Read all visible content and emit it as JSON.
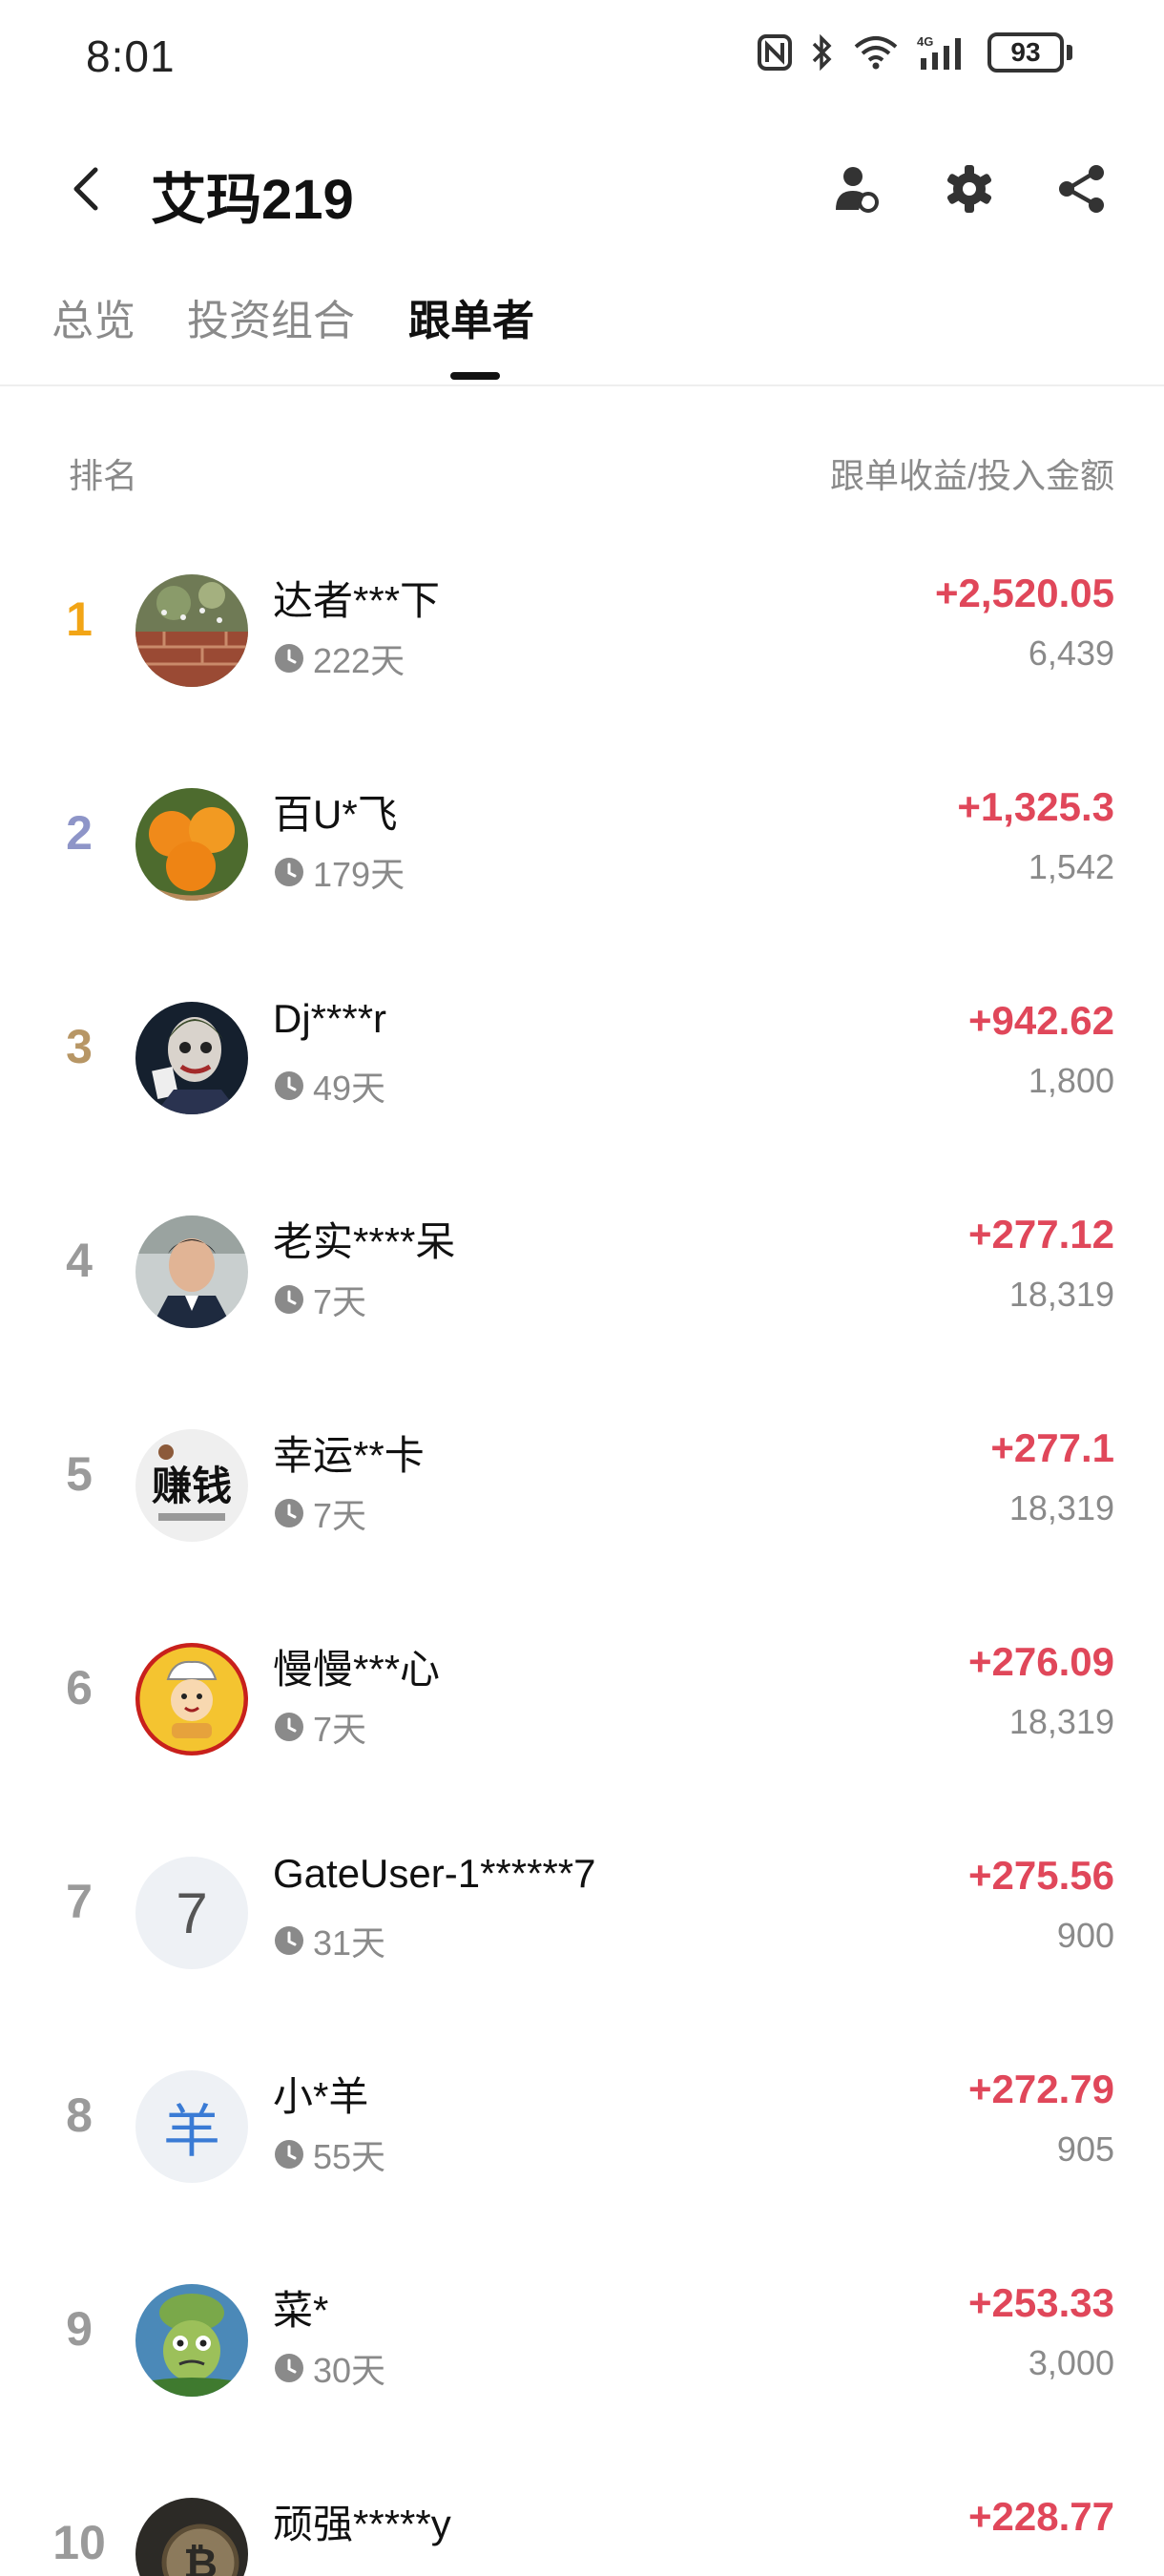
{
  "status_bar": {
    "time": "8:01",
    "battery": "93",
    "icons": [
      "nfc-icon",
      "bluetooth-icon",
      "wifi-icon",
      "signal-4g-icon"
    ]
  },
  "header": {
    "title": "艾玛219",
    "icons": [
      "back-icon",
      "user-manage-icon",
      "gear-icon",
      "share-icon"
    ]
  },
  "tabs": [
    {
      "label": "总览"
    },
    {
      "label": "投资组合"
    },
    {
      "label": "跟单者"
    }
  ],
  "active_tab": "跟单者",
  "columns": {
    "left": "排名",
    "right": "跟单收益/投入金额"
  },
  "colors": {
    "profit": "#e0475a",
    "rank_1": "#f2a516",
    "rank_2": "#8e95c8",
    "rank_3": "#b79665",
    "rank_default": "#9a9a9a"
  },
  "followers": [
    {
      "rank": "1",
      "name": "达者***下",
      "days": "222天",
      "profit": "+2,520.05",
      "invest": "6,439",
      "avatar": "photo-brick-wall"
    },
    {
      "rank": "2",
      "name": "百U*飞",
      "days": "179天",
      "profit": "+1,325.3",
      "invest": "1,542",
      "avatar": "photo-oranges"
    },
    {
      "rank": "3",
      "name": "Dj****r",
      "days": "49天",
      "profit": "+942.62",
      "invest": "1,800",
      "avatar": "photo-joker"
    },
    {
      "rank": "4",
      "name": "老实****呆",
      "days": "7天",
      "profit": "+277.12",
      "invest": "18,319",
      "avatar": "photo-man-suit"
    },
    {
      "rank": "5",
      "name": "幸运**卡",
      "days": "7天",
      "profit": "+277.1",
      "invest": "18,319",
      "avatar": "image-zhuanqian",
      "avatar_text": "赚钱"
    },
    {
      "rank": "6",
      "name": "慢慢***心",
      "days": "7天",
      "profit": "+276.09",
      "invest": "18,319",
      "avatar": "cartoon-chef"
    },
    {
      "rank": "7",
      "name": "GateUser-1******7",
      "days": "31天",
      "profit": "+275.56",
      "invest": "900",
      "avatar": "letter",
      "avatar_text": "7"
    },
    {
      "rank": "8",
      "name": "小*羊",
      "days": "55天",
      "profit": "+272.79",
      "invest": "905",
      "avatar": "letter",
      "avatar_text": "羊"
    },
    {
      "rank": "9",
      "name": "菜*",
      "days": "30天",
      "profit": "+253.33",
      "invest": "3,000",
      "avatar": "cartoon-plant"
    },
    {
      "rank": "10",
      "name": "顽强*****y",
      "days": "",
      "profit": "+228.77",
      "invest": "",
      "avatar": "photo-bitcoin"
    }
  ]
}
